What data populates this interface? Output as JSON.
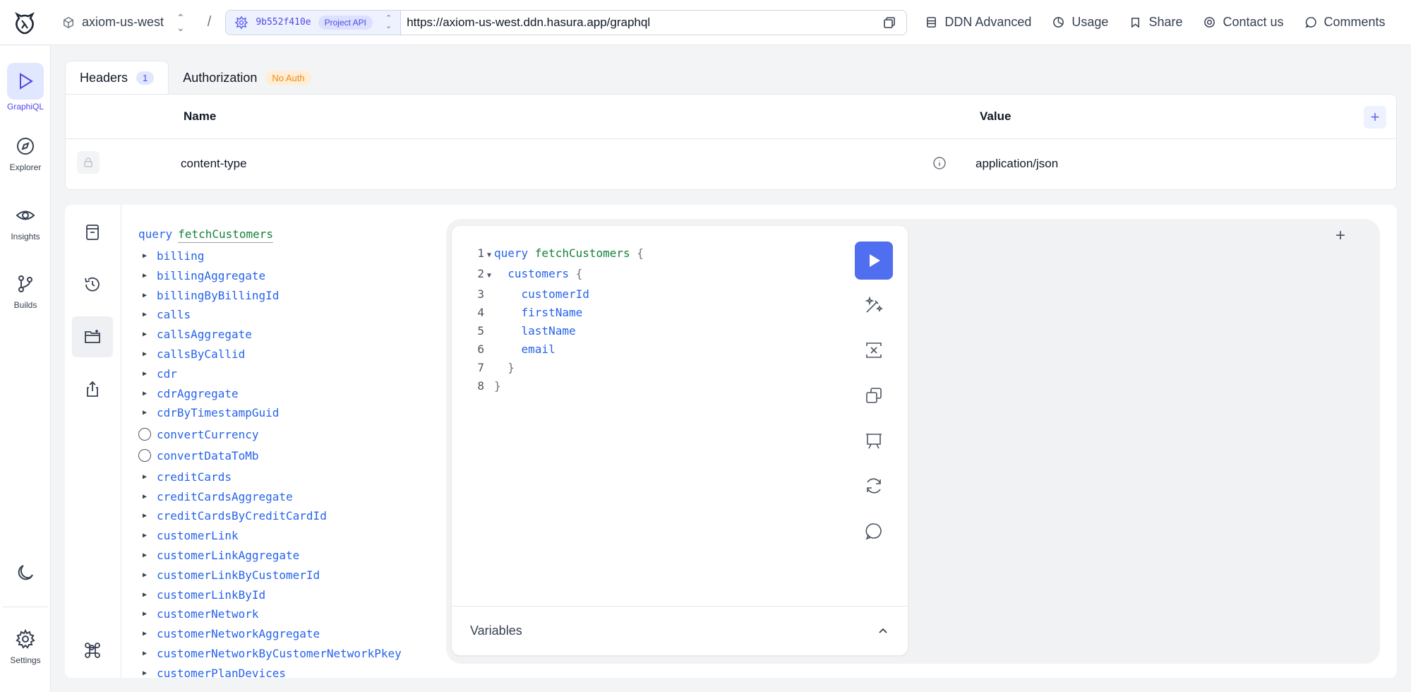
{
  "topbar": {
    "project_name": "axiom-us-west",
    "separator": "/",
    "build_id": "9b552f410e",
    "build_badge": "Project API",
    "url": "https://axiom-us-west.ddn.hasura.app/graphql",
    "links": [
      {
        "label": "DDN Advanced",
        "icon": "server-icon"
      },
      {
        "label": "Usage",
        "icon": "usage-icon"
      },
      {
        "label": "Share",
        "icon": "share-icon"
      },
      {
        "label": "Contact us",
        "icon": "support-icon"
      },
      {
        "label": "Comments",
        "icon": "comment-icon"
      }
    ]
  },
  "rail": {
    "items": [
      {
        "label": "GraphiQL",
        "icon": "play-icon",
        "active": true
      },
      {
        "label": "Explorer",
        "icon": "compass-icon"
      },
      {
        "label": "Insights",
        "icon": "eye-icon"
      },
      {
        "label": "Builds",
        "icon": "git-branch-icon"
      }
    ],
    "settings_label": "Settings"
  },
  "headers_panel": {
    "tabs": [
      {
        "label": "Headers",
        "badge": "1",
        "active": true
      },
      {
        "label": "Authorization",
        "badge": "No Auth"
      }
    ],
    "columns": [
      "Name",
      "Value"
    ],
    "rows": [
      {
        "name": "content-type",
        "value": "application/json",
        "locked": true
      }
    ]
  },
  "explorer": {
    "keyword": "query",
    "operation_name": "fetchCustomers",
    "items": [
      {
        "label": "billing",
        "kind": "arrow"
      },
      {
        "label": "billingAggregate",
        "kind": "arrow"
      },
      {
        "label": "billingByBillingId",
        "kind": "arrow"
      },
      {
        "label": "calls",
        "kind": "arrow"
      },
      {
        "label": "callsAggregate",
        "kind": "arrow"
      },
      {
        "label": "callsByCallid",
        "kind": "arrow"
      },
      {
        "label": "cdr",
        "kind": "arrow"
      },
      {
        "label": "cdrAggregate",
        "kind": "arrow"
      },
      {
        "label": "cdrByTimestampGuid",
        "kind": "arrow"
      },
      {
        "label": "convertCurrency",
        "kind": "radio"
      },
      {
        "label": "convertDataToMb",
        "kind": "radio"
      },
      {
        "label": "creditCards",
        "kind": "arrow"
      },
      {
        "label": "creditCardsAggregate",
        "kind": "arrow"
      },
      {
        "label": "creditCardsByCreditCardId",
        "kind": "arrow"
      },
      {
        "label": "customerLink",
        "kind": "arrow"
      },
      {
        "label": "customerLinkAggregate",
        "kind": "arrow"
      },
      {
        "label": "customerLinkByCustomerId",
        "kind": "arrow"
      },
      {
        "label": "customerLinkById",
        "kind": "arrow"
      },
      {
        "label": "customerNetwork",
        "kind": "arrow"
      },
      {
        "label": "customerNetworkAggregate",
        "kind": "arrow"
      },
      {
        "label": "customerNetworkByCustomerNetworkPkey",
        "kind": "arrow"
      },
      {
        "label": "customerPlanDevices",
        "kind": "arrow"
      }
    ]
  },
  "editor": {
    "lines": [
      {
        "n": "1",
        "fold": "▼",
        "tokens": [
          [
            "kw",
            "query "
          ],
          [
            "nm",
            "fetchCustomers"
          ],
          [
            "pn",
            " {"
          ]
        ]
      },
      {
        "n": "2",
        "fold": "▼",
        "tokens": [
          [
            "fd",
            "  customers"
          ],
          [
            "pn",
            " {"
          ]
        ]
      },
      {
        "n": "3",
        "fold": "",
        "tokens": [
          [
            "fd",
            "    customerId"
          ]
        ]
      },
      {
        "n": "4",
        "fold": "",
        "tokens": [
          [
            "fd",
            "    firstName"
          ]
        ]
      },
      {
        "n": "5",
        "fold": "",
        "tokens": [
          [
            "fd",
            "    lastName"
          ]
        ]
      },
      {
        "n": "6",
        "fold": "",
        "tokens": [
          [
            "fd",
            "    email"
          ]
        ]
      },
      {
        "n": "7",
        "fold": "",
        "tokens": [
          [
            "pn",
            "  }"
          ]
        ]
      },
      {
        "n": "8",
        "fold": "",
        "tokens": [
          [
            "pn",
            "}"
          ]
        ]
      }
    ],
    "variables_label": "Variables",
    "new_tab_label": "+"
  },
  "colors": {
    "accent": "#4f6ef0",
    "keyword": "#2563eb",
    "operation_name": "#15803d",
    "no_auth_badge": "#ea8c1a"
  }
}
